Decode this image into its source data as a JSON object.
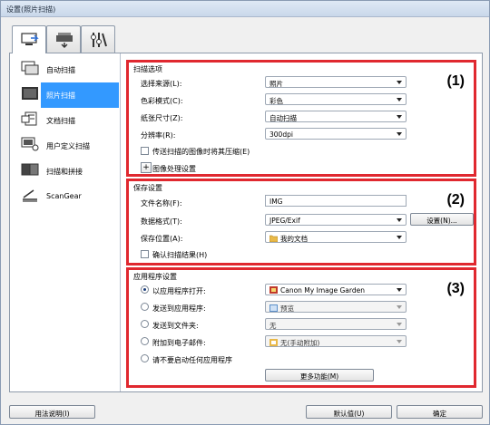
{
  "window": {
    "title": "设置(照片扫描)"
  },
  "tabs": [
    {
      "icon": "scan-from-computer-icon"
    },
    {
      "icon": "scan-from-operation-panel-icon"
    },
    {
      "icon": "general-settings-icon"
    }
  ],
  "sidebar": {
    "items": [
      {
        "label": "自动扫描",
        "icon": "auto-scan-icon"
      },
      {
        "label": "照片扫描",
        "icon": "photo-scan-icon",
        "selected": true
      },
      {
        "label": "文档扫描",
        "icon": "document-scan-icon"
      },
      {
        "label": "用户定义扫描",
        "icon": "custom-scan-icon"
      },
      {
        "label": "扫描和拼接",
        "icon": "scan-stitch-icon"
      },
      {
        "label": "ScanGear",
        "icon": "scangear-icon"
      }
    ]
  },
  "scan_options": {
    "title": "扫描选项",
    "number": "(1)",
    "source_label": "选择来源(L):",
    "source_value": "照片",
    "color_label": "色彩模式(C):",
    "color_value": "彩色",
    "paper_label": "纸张尺寸(Z):",
    "paper_value": "自动扫描",
    "resolution_label": "分辨率(R):",
    "resolution_value": "300dpi",
    "compress_label": "传送扫描的图像时将其压缩(E)",
    "image_processing_label": "图像处理设置"
  },
  "save_settings": {
    "title": "保存设置",
    "number": "(2)",
    "filename_label": "文件名称(F):",
    "filename_value": "IMG",
    "format_label": "数据格式(T):",
    "format_value": "JPEG/Exif",
    "settings_button": "设置(N)...",
    "location_label": "保存位置(A):",
    "location_value": "我的文档",
    "confirm_label": "确认扫描结果(H)"
  },
  "app_settings": {
    "title": "应用程序设置",
    "number": "(3)",
    "open_app_label": "以应用程序打开:",
    "open_app_value": "Canon My Image Garden",
    "send_app_label": "发送到应用程序:",
    "send_app_value": "预览",
    "send_folder_label": "发送到文件夹:",
    "send_folder_value": "无",
    "email_label": "附加到电子邮件:",
    "email_value": "无(手动附加)",
    "no_app_label": "请不要启动任何应用程序",
    "more_button": "更多功能(M)"
  },
  "footer": {
    "help_button": "用法说明(I)",
    "defaults_button": "默认值(U)",
    "ok_button": "确定"
  },
  "colors": {
    "highlight": "#3399ff",
    "section_border": "#e0282f"
  }
}
